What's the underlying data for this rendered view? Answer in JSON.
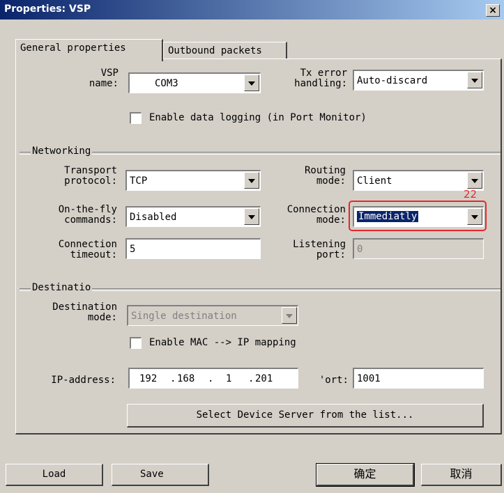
{
  "window": {
    "title": "Properties: VSP",
    "close_glyph": "×"
  },
  "tabs": [
    {
      "label": "General properties",
      "active": true
    },
    {
      "label": "Outbound packets",
      "active": false
    }
  ],
  "vsp": {
    "name_label": "VSP\nname:",
    "name_value": "COM3",
    "tx_error_label": "Tx error\nhandling:",
    "tx_error_value": "Auto-discard",
    "data_logging_label": "Enable data logging (in Port Monitor)",
    "data_logging_checked": false
  },
  "networking": {
    "group_label": "Networking",
    "transport_label": "Transport\nprotocol:",
    "transport_value": "TCP",
    "routing_label": "Routing\nmode:",
    "routing_value": "Client",
    "onthefly_label": "On-the-fly\ncommands:",
    "onthefly_value": "Disabled",
    "connection_mode_label": "Connection\nmode:",
    "connection_mode_value": "Immediatly",
    "conn_timeout_label": "Connection\ntimeout:",
    "conn_timeout_value": "5",
    "listening_port_label": "Listening\nport:",
    "listening_port_value": "0"
  },
  "destination": {
    "group_label": "Destinatio",
    "mode_label": "Destination\nmode:",
    "mode_value": "Single destination",
    "mac_mapping_label": "Enable MAC --> IP mapping",
    "mac_mapping_checked": false,
    "ip_label": "IP-address:",
    "ip_octets": [
      "192",
      "168",
      "1",
      "201"
    ],
    "ip_dots": ".",
    "port_label": "'ort:",
    "port_value": "1001",
    "select_server_label": "Select Device Server from the list..."
  },
  "buttons": {
    "load": "Load",
    "save": "Save",
    "ok": "确定",
    "cancel": "取消"
  },
  "annotation": {
    "number": "22",
    "color": "#e8262a"
  },
  "colors": {
    "face": "#d4d0c8",
    "selection": "#0a246a",
    "title_start": "#0a246a",
    "title_end": "#a6caf0"
  }
}
